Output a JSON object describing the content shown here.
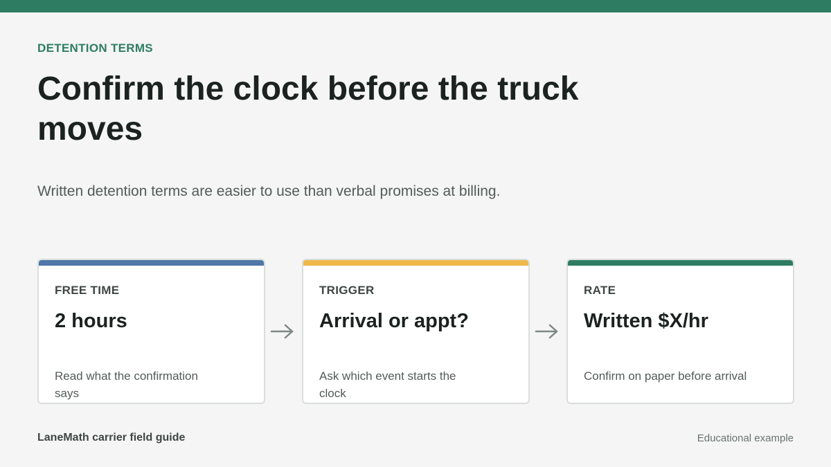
{
  "colors": {
    "brand": "#2e7d62",
    "free_time_accent": "#4f77a8",
    "trigger_accent": "#f0b84a",
    "rate_accent": "#2e7d62",
    "arrow": "#7e8884"
  },
  "header": {
    "eyebrow": "DETENTION TERMS",
    "title": "Confirm the clock before the truck moves",
    "subtitle": "Written detention terms are easier to use than verbal promises at billing."
  },
  "cards": [
    {
      "label": "FREE TIME",
      "value": "2 hours",
      "note": "Read what the confirmation says"
    },
    {
      "label": "TRIGGER",
      "value": "Arrival or appt?",
      "note": "Ask which event starts the clock"
    },
    {
      "label": "RATE",
      "value": "Written $X/hr",
      "note": "Confirm on paper before arrival"
    }
  ],
  "footer": {
    "brand": "LaneMath carrier field guide",
    "disclaimer": "Educational example"
  },
  "icons": {
    "step_arrow": "arrow-right-icon"
  }
}
